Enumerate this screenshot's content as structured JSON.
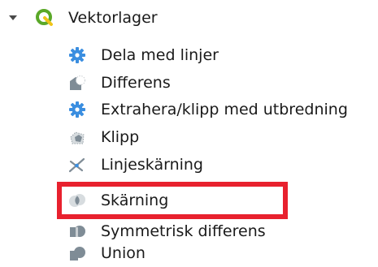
{
  "tree": {
    "group": {
      "label": "Vektorlager",
      "icon": "qgis-logo-icon",
      "expanded": true
    },
    "items": [
      {
        "label": "Dela med linjer",
        "icon": "gear-icon"
      },
      {
        "label": "Differens",
        "icon": "difference-icon"
      },
      {
        "label": "Extrahera/klipp med utbredning",
        "icon": "gear-icon"
      },
      {
        "label": "Klipp",
        "icon": "clip-icon"
      },
      {
        "label": "Linjeskärning",
        "icon": "line-intersection-icon"
      },
      {
        "label": "Skärning",
        "icon": "intersection-icon",
        "highlighted": true
      },
      {
        "label": "Symmetrisk differens",
        "icon": "symmetric-difference-icon"
      },
      {
        "label": "Union",
        "icon": "union-icon"
      }
    ]
  },
  "colors": {
    "highlight_border": "#e8212e",
    "gear_blue": "#3a8ee0",
    "polygon_gray": "#7f8c96",
    "qgis_green": "#5aa828",
    "qgis_yellow": "#f0c419"
  }
}
